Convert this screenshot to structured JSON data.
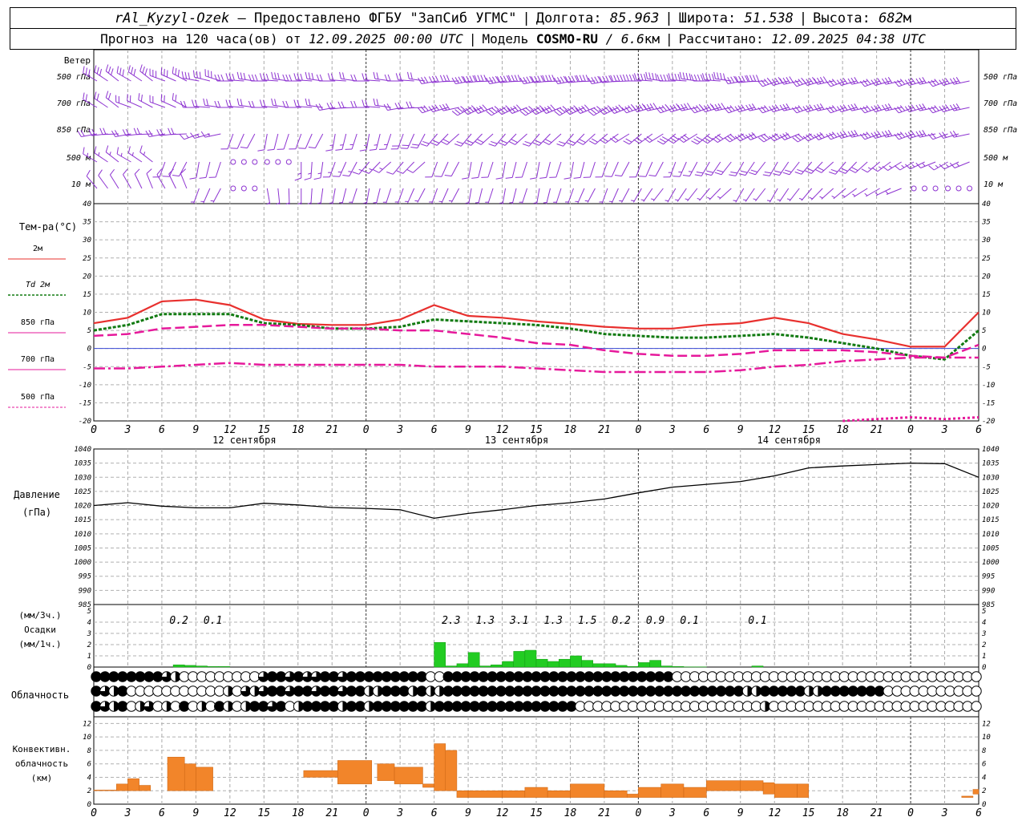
{
  "header": {
    "line1": {
      "station": "rAl_Kyzyl-Ozek",
      "provided": "— Предоставлено ФГБУ \"ЗапСиб УГМС\"",
      "lon_label": "Долгота:",
      "lon_value": "85.963",
      "lat_label": "Широта:",
      "lat_value": "51.538",
      "alt_label": "Высота:",
      "alt_value": "682",
      "alt_unit": "м"
    },
    "line2": {
      "forecast_label": "Прогноз на 120 часа(ов) от",
      "forecast_time": "12.09.2025 00:00 UTC",
      "model_label": "Модель",
      "model_name": "COSMO-RU",
      "model_res": "/ 6.6",
      "model_res_unit": "км",
      "calc_label": "Рассчитано:",
      "calc_time": "12.09.2025 04:38 UTC"
    }
  },
  "colors": {
    "t2m": "#e8302e",
    "td2m": "#117a11",
    "t850": "#e6199b",
    "t700": "#e6199b",
    "t500": "#e6199b",
    "wind": "#8d33d1",
    "precip": "#22cc22",
    "conv": "#f2852a",
    "pressure": "#000000",
    "zero_line": "#3a49d6"
  },
  "labels": {
    "wind": {
      "title": "Ветер",
      "levels": [
        "500 гПа",
        "700 гПа",
        "850 гПа",
        "500 м",
        "10  м"
      ]
    },
    "temp": {
      "title": "Тем-ра(°C)",
      "legend": [
        "2м",
        "Td  2м",
        "850 гПа",
        "700 гПа",
        "500 гПа"
      ]
    },
    "pressure": {
      "title": "Давление",
      "unit": "(гПа)"
    },
    "precip": {
      "unit3h": "(мм/3ч.)",
      "title": "Осадки",
      "unit1h": "(мм/1ч.)"
    },
    "cloud": {
      "title": "Облачность"
    },
    "conv": {
      "title": [
        "Конвективн.",
        "облачность",
        "(км)"
      ]
    }
  },
  "time_axis": {
    "hour_labels": [
      "0",
      "3",
      "6",
      "9",
      "12",
      "15",
      "18",
      "21",
      "0",
      "3",
      "6",
      "9",
      "12",
      "15",
      "18",
      "21",
      "0",
      "3",
      "6",
      "9",
      "12",
      "15",
      "18",
      "21",
      "0",
      "3",
      "6"
    ],
    "days": [
      "12 сентября",
      "13 сентября",
      "14 сентября"
    ]
  },
  "chart_data": [
    {
      "type": "line",
      "name": "temperature",
      "ylim": [
        -20,
        40
      ],
      "yticks": [
        -20,
        -15,
        -10,
        -5,
        0,
        5,
        10,
        15,
        20,
        25,
        30,
        35,
        40
      ],
      "x_hours": [
        0,
        3,
        6,
        9,
        12,
        15,
        18,
        21,
        24,
        27,
        30,
        33,
        36,
        39,
        42,
        45,
        48,
        51,
        54,
        57,
        60,
        63,
        66,
        69,
        72,
        75,
        78
      ],
      "series": [
        {
          "name": "2м",
          "values": [
            7,
            8.5,
            13,
            13.5,
            12,
            8,
            6.8,
            6.5,
            6.5,
            8,
            12,
            9,
            8.5,
            7.5,
            6.8,
            6,
            5.5,
            5.5,
            6.5,
            7,
            8.5,
            7,
            4,
            2.5,
            0.5,
            0.5,
            10
          ]
        },
        {
          "name": "Td  2м",
          "values": [
            5,
            6.5,
            9.5,
            9.5,
            9.5,
            7,
            6.5,
            5.5,
            5.5,
            6,
            8,
            7.5,
            7,
            6.5,
            5.5,
            4,
            3.5,
            3,
            3,
            3.5,
            4,
            3,
            1.5,
            0,
            -2,
            -3,
            5
          ]
        },
        {
          "name": "850 гПа",
          "values": [
            3.5,
            4,
            5.5,
            6,
            6.5,
            6.5,
            6,
            5.5,
            5.5,
            5,
            5,
            4,
            3,
            1.5,
            1,
            -0.5,
            -1.5,
            -2,
            -2,
            -1.5,
            -0.5,
            -0.5,
            -0.5,
            -1,
            -2,
            -2.5,
            1
          ]
        },
        {
          "name": "700 гПа",
          "values": [
            -5.5,
            -5.5,
            -5,
            -4.5,
            -4,
            -4.5,
            -4.5,
            -4.5,
            -4.5,
            -4.5,
            -5,
            -5,
            -5,
            -5.5,
            -6,
            -6.5,
            -6.5,
            -6.5,
            -6.5,
            -6,
            -5,
            -4.5,
            -3.5,
            -3,
            -2.5,
            -2.5,
            -2.5
          ]
        },
        {
          "name": "500 гПа",
          "x_hours": [
            66,
            69,
            72,
            75,
            78
          ],
          "values": [
            -20,
            -19.5,
            -19,
            -19.5,
            -19
          ]
        }
      ]
    },
    {
      "type": "line",
      "name": "pressure",
      "ylim": [
        985,
        1040
      ],
      "yticks": [
        985,
        990,
        995,
        1000,
        1005,
        1010,
        1015,
        1020,
        1025,
        1030,
        1035,
        1040
      ],
      "x_hours": [
        0,
        3,
        6,
        9,
        12,
        15,
        18,
        21,
        24,
        27,
        30,
        33,
        36,
        39,
        42,
        45,
        48,
        51,
        54,
        57,
        60,
        63,
        66,
        69,
        72,
        75,
        78
      ],
      "values": [
        1020,
        1021,
        1019.8,
        1019.2,
        1019.2,
        1020.8,
        1020.2,
        1019.3,
        1019,
        1018.5,
        1015.5,
        1017.2,
        1018.5,
        1020,
        1021,
        1022.3,
        1024.5,
        1026.5,
        1027.5,
        1028.5,
        1030.5,
        1033.3,
        1034,
        1034.5,
        1035,
        1034.8,
        1030
      ],
      "title": "Давление",
      "ylabel": "(гПа)"
    },
    {
      "type": "bar",
      "name": "precipitation",
      "ylim": [
        0,
        5
      ],
      "yticks": [
        0,
        1,
        2,
        3,
        4,
        5
      ],
      "x_hours": [
        7,
        8,
        9,
        10,
        11,
        30,
        31,
        32,
        33,
        34,
        35,
        36,
        37,
        38,
        39,
        40,
        41,
        42,
        43,
        44,
        45,
        46,
        47,
        48,
        49,
        50,
        51,
        52,
        53,
        58
      ],
      "values": [
        0.2,
        0.15,
        0.1,
        0.05,
        0.05,
        2.2,
        0.1,
        0.3,
        1.3,
        0.1,
        0.2,
        0.5,
        1.4,
        1.5,
        0.7,
        0.5,
        0.7,
        1,
        0.6,
        0.3,
        0.3,
        0.15,
        0.05,
        0.4,
        0.6,
        0.1,
        0.05,
        0.02,
        0.02,
        0.1
      ],
      "annotations": [
        {
          "x_hour": 7.5,
          "text": "0.2"
        },
        {
          "x_hour": 10.5,
          "text": "0.1"
        },
        {
          "x_hour": 31.5,
          "text": "2.3"
        },
        {
          "x_hour": 34.5,
          "text": "1.3"
        },
        {
          "x_hour": 37.5,
          "text": "3.1"
        },
        {
          "x_hour": 40.5,
          "text": "1.3"
        },
        {
          "x_hour": 43.5,
          "text": "1.5"
        },
        {
          "x_hour": 46.5,
          "text": "0.2"
        },
        {
          "x_hour": 49.5,
          "text": "0.9"
        },
        {
          "x_hour": 52.5,
          "text": "0.1"
        },
        {
          "x_hour": 58.5,
          "text": "0.1"
        }
      ]
    },
    {
      "type": "bar",
      "name": "convective_cloud",
      "ylim": [
        0,
        13
      ],
      "yticks": [
        0,
        2,
        4,
        6,
        8,
        10,
        12
      ],
      "segments": [
        {
          "x0": 0,
          "x1": 2,
          "base": 2,
          "top": 2.1
        },
        {
          "x0": 2,
          "x1": 3,
          "base": 2,
          "top": 3
        },
        {
          "x0": 3,
          "x1": 4,
          "base": 2,
          "top": 3.8
        },
        {
          "x0": 4,
          "x1": 5,
          "base": 2,
          "top": 2.8
        },
        {
          "x0": 6.5,
          "x1": 8,
          "base": 2,
          "top": 7
        },
        {
          "x0": 8,
          "x1": 9,
          "base": 2,
          "top": 6
        },
        {
          "x0": 9,
          "x1": 10.5,
          "base": 2,
          "top": 5.5
        },
        {
          "x0": 18.5,
          "x1": 21.5,
          "base": 4,
          "top": 5
        },
        {
          "x0": 21.5,
          "x1": 24.5,
          "base": 3,
          "top": 6.5
        },
        {
          "x0": 25,
          "x1": 26.5,
          "base": 3.5,
          "top": 6
        },
        {
          "x0": 26.5,
          "x1": 29,
          "base": 3,
          "top": 5.5
        },
        {
          "x0": 29,
          "x1": 30,
          "base": 2.5,
          "top": 3
        },
        {
          "x0": 30,
          "x1": 31,
          "base": 2,
          "top": 9
        },
        {
          "x0": 31,
          "x1": 32,
          "base": 2,
          "top": 8
        },
        {
          "x0": 32,
          "x1": 33,
          "base": 1,
          "top": 2
        },
        {
          "x0": 33,
          "x1": 36,
          "base": 1,
          "top": 2
        },
        {
          "x0": 36,
          "x1": 38,
          "base": 1,
          "top": 2
        },
        {
          "x0": 38,
          "x1": 40,
          "base": 1,
          "top": 2.5
        },
        {
          "x0": 40,
          "x1": 42,
          "base": 1,
          "top": 2
        },
        {
          "x0": 42,
          "x1": 45,
          "base": 1,
          "top": 3
        },
        {
          "x0": 45,
          "x1": 47,
          "base": 1,
          "top": 2
        },
        {
          "x0": 47,
          "x1": 48,
          "base": 1,
          "top": 1.5
        },
        {
          "x0": 48,
          "x1": 50,
          "base": 1,
          "top": 2.5
        },
        {
          "x0": 50,
          "x1": 52,
          "base": 1,
          "top": 3
        },
        {
          "x0": 52,
          "x1": 54,
          "base": 1,
          "top": 2.5
        },
        {
          "x0": 54,
          "x1": 57,
          "base": 2,
          "top": 3.5
        },
        {
          "x0": 57,
          "x1": 59,
          "base": 2,
          "top": 3.5
        },
        {
          "x0": 59,
          "x1": 60,
          "base": 1.5,
          "top": 3.2
        },
        {
          "x0": 60,
          "x1": 62,
          "base": 1,
          "top": 3
        },
        {
          "x0": 62,
          "x1": 63,
          "base": 1,
          "top": 3
        },
        {
          "x0": 76.5,
          "x1": 77.5,
          "base": 1,
          "top": 1.2
        },
        {
          "x0": 77.5,
          "x1": 78,
          "base": 1.5,
          "top": 2.2
        }
      ]
    },
    {
      "type": "table",
      "name": "cloudiness",
      "rows": [
        "88888888642222222226886866886888888888228888888888888888888888888822222222222222222222222222222222222",
        "86482222222222242646886886886884488848448888888888888888888888888888888888448888844888888822222222222",
        "86482462428242842488682488884884888888488888888888888882222222222222222222224222222222222222222222222"
      ],
      "encoding": "okta-like: 0=clear,2=quarter,4=half,6=three-quarter,8=overcast"
    },
    {
      "type": "scatter",
      "name": "wind_barbs",
      "levels": [
        "500 гПа",
        "700 гПа",
        "850 гПа",
        "500 м",
        "10  м"
      ],
      "direction_deg": [
        [
          300,
          300,
          290,
          280,
          270,
          270,
          270,
          270,
          270,
          270,
          260,
          260,
          260,
          260,
          260,
          260,
          270,
          270,
          270,
          260,
          250,
          250,
          250,
          250,
          250,
          250,
          250
        ],
        [
          300,
          290,
          290,
          270,
          270,
          270,
          270,
          260,
          270,
          260,
          250,
          240,
          240,
          240,
          240,
          240,
          250,
          250,
          250,
          250,
          250,
          250,
          250,
          250,
          250,
          250,
          250
        ],
        [
          260,
          260,
          260,
          250,
          200,
          190,
          200,
          190,
          190,
          200,
          220,
          220,
          220,
          220,
          220,
          230,
          230,
          230,
          230,
          240,
          240,
          240,
          250,
          250,
          250,
          250,
          250
        ],
        [
          300,
          300,
          200,
          190,
          180,
          180,
          180,
          200,
          220,
          220,
          200,
          190,
          190,
          190,
          190,
          200,
          200,
          200,
          210,
          210,
          210,
          220,
          220,
          230,
          240,
          240,
          240
        ],
        [
          320,
          330,
          330,
          200,
          180,
          170,
          180,
          190,
          190,
          200,
          200,
          190,
          190,
          190,
          200,
          200,
          210,
          210,
          220,
          210,
          210,
          220,
          230,
          240,
          240,
          240,
          240
        ]
      ],
      "speed_ms": [
        [
          15,
          15,
          15,
          15,
          15,
          15,
          15,
          12,
          10,
          10,
          15,
          20,
          20,
          20,
          20,
          20,
          20,
          20,
          20,
          20,
          20,
          20,
          15,
          15,
          15,
          15,
          15
        ],
        [
          12,
          12,
          10,
          10,
          10,
          10,
          10,
          10,
          10,
          10,
          15,
          20,
          20,
          20,
          20,
          20,
          20,
          20,
          20,
          15,
          15,
          15,
          15,
          15,
          15,
          15,
          15
        ],
        [
          10,
          10,
          10,
          8,
          5,
          5,
          5,
          8,
          8,
          10,
          10,
          10,
          10,
          10,
          10,
          10,
          10,
          15,
          15,
          15,
          15,
          15,
          15,
          15,
          15,
          12,
          12
        ],
        [
          8,
          8,
          5,
          5,
          0,
          0,
          8,
          8,
          8,
          5,
          5,
          5,
          5,
          5,
          5,
          5,
          5,
          8,
          10,
          10,
          10,
          10,
          10,
          8,
          8,
          8,
          8
        ],
        [
          5,
          5,
          5,
          3,
          0,
          3,
          3,
          3,
          3,
          3,
          3,
          3,
          3,
          3,
          3,
          3,
          3,
          3,
          3,
          3,
          3,
          3,
          3,
          3,
          0,
          0,
          3
        ]
      ]
    }
  ]
}
